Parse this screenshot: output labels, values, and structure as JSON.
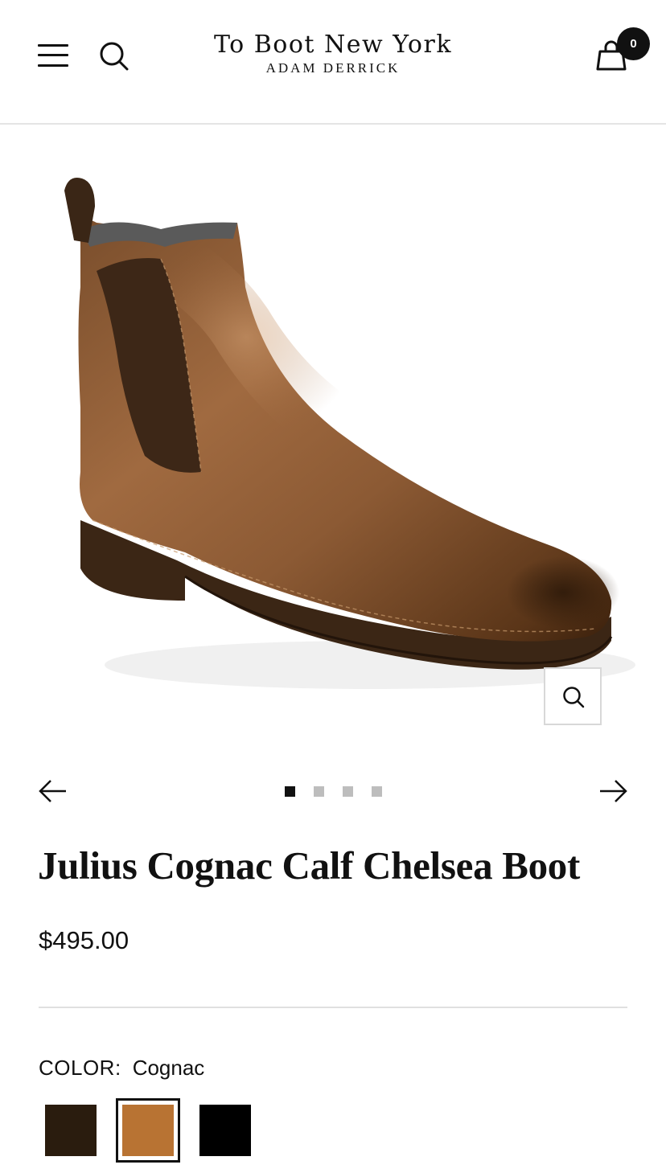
{
  "header": {
    "logo_main": "To Boot New York",
    "logo_sub": "Adam Derrick",
    "menu_icon": "hamburger-menu-icon",
    "search_icon": "search-icon",
    "cart_icon": "shopping-bag-icon",
    "cart_count": "0"
  },
  "gallery": {
    "image_alt": "Julius Cognac Calf Chelsea Boot",
    "zoom_icon": "zoom-icon",
    "prev_icon": "arrow-left-icon",
    "next_icon": "arrow-right-icon",
    "slide_count": 4,
    "active_slide": 1
  },
  "product": {
    "title": "Julius Cognac Calf Chelsea Boot",
    "price": "$495.00",
    "color_label": "COLOR:",
    "color_value": "Cognac",
    "swatches": [
      {
        "name": "Dark Brown",
        "color": "#2a1c0e",
        "selected": false
      },
      {
        "name": "Cognac",
        "color": "#b87333",
        "selected": true
      },
      {
        "name": "Black",
        "color": "#000000",
        "selected": false
      }
    ]
  }
}
